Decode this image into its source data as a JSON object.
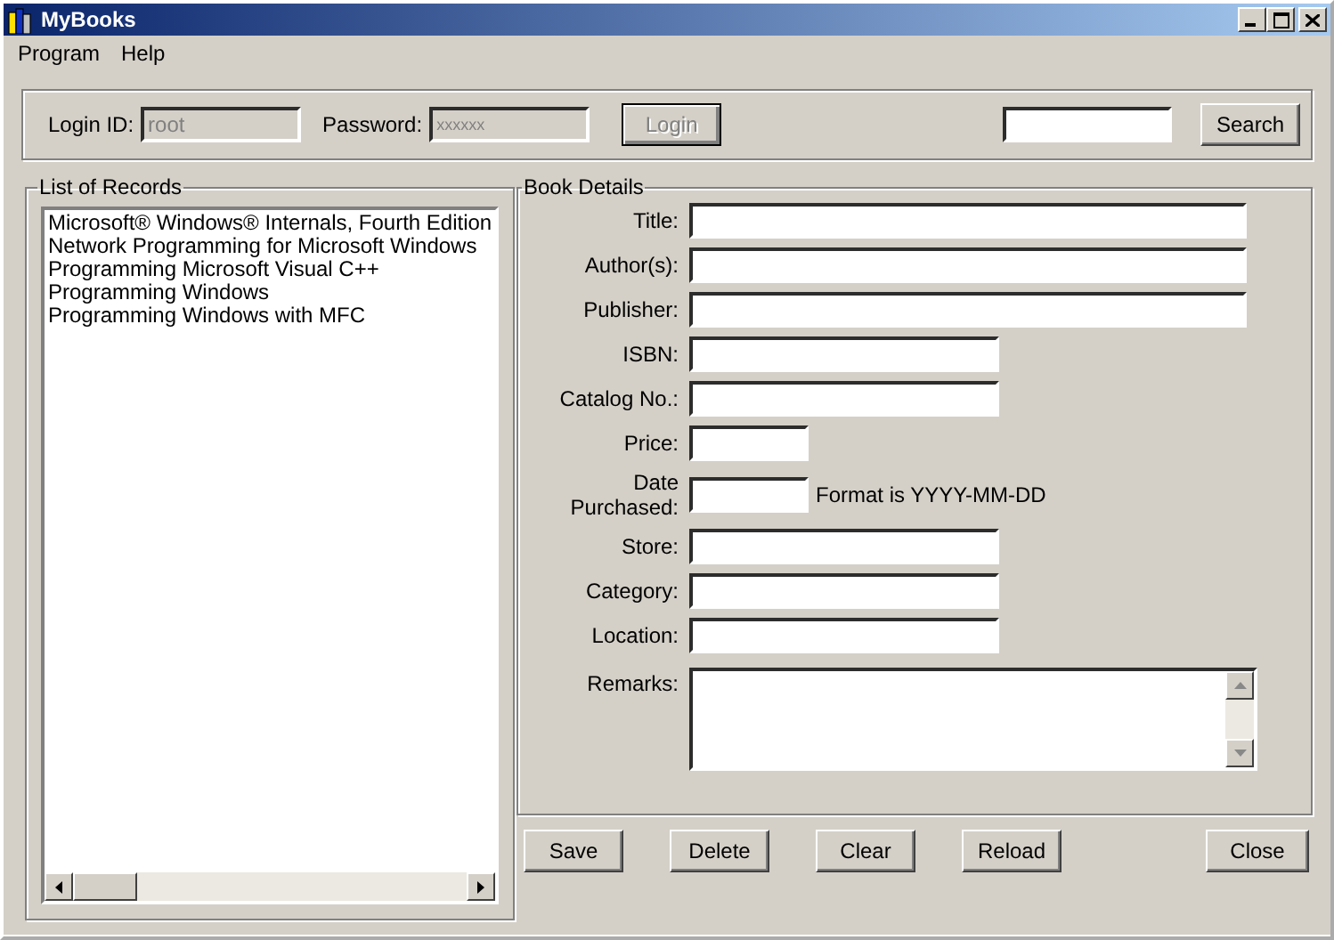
{
  "window": {
    "title": "MyBooks"
  },
  "menu": [
    {
      "label": "Program"
    },
    {
      "label": "Help"
    }
  ],
  "login": {
    "id_label": "Login ID:",
    "id_value": "root",
    "password_label": "Password:",
    "password_value": "xxxxxx",
    "disabled": true,
    "button": "Login"
  },
  "search": {
    "button": "Search"
  },
  "records": {
    "title": "List of Records",
    "items": [
      {
        "label": "Microsoft® Windows® Internals, Fourth Edition",
        "selected": false
      },
      {
        "label": "Network Programming for Microsoft Windows",
        "selected": false
      },
      {
        "label": "Programming Microsoft Visual C++",
        "selected": false
      },
      {
        "label": "Programming Windows",
        "selected": false
      },
      {
        "label": "Programming Windows with MFC",
        "selected": false
      }
    ]
  },
  "details": {
    "title": "Book Details",
    "fields": [
      {
        "label": "Title:",
        "kind": "wide"
      },
      {
        "label": "Author(s):",
        "kind": "wide"
      },
      {
        "label": "Publisher:",
        "kind": "wide"
      },
      {
        "label": "ISBN:",
        "kind": "medium"
      },
      {
        "label": "Catalog No.:",
        "kind": "medium"
      },
      {
        "label": "Price:",
        "kind": "small"
      },
      {
        "label": "Date Purchased:",
        "kind": "small",
        "hint": "Format is YYYY-MM-DD"
      },
      {
        "label": "Store:",
        "kind": "medium"
      },
      {
        "label": "Category:",
        "kind": "medium"
      },
      {
        "label": "Location:",
        "kind": "medium"
      },
      {
        "label": "Remarks:",
        "kind": "area"
      }
    ]
  },
  "buttons": [
    {
      "label": "Save"
    },
    {
      "label": "Delete"
    },
    {
      "label": "Clear"
    },
    {
      "label": "Reload"
    }
  ],
  "close_button": "Close"
}
